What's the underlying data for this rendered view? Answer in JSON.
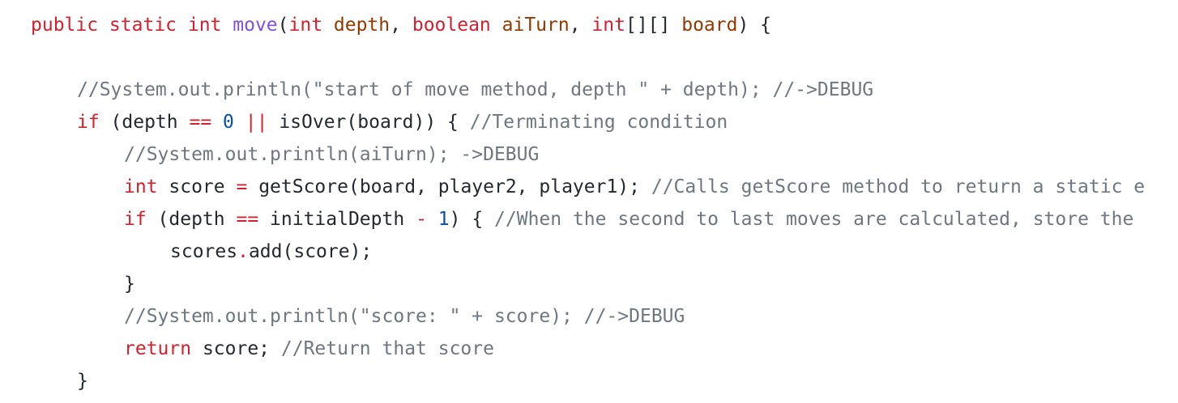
{
  "colors": {
    "background": "#ffffff",
    "keyword": "#cf222e",
    "function_name": "#8250df",
    "parameter": "#953800",
    "comment": "#6e7781",
    "number": "#0550ae",
    "plain": "#24292f"
  },
  "code": {
    "lines": [
      [
        {
          "t": "public static int ",
          "c": "kw"
        },
        {
          "t": "move",
          "c": "fn"
        },
        {
          "t": "(",
          "c": "tx"
        },
        {
          "t": "int ",
          "c": "kw"
        },
        {
          "t": "depth",
          "c": "pm"
        },
        {
          "t": ", ",
          "c": "tx"
        },
        {
          "t": "boolean ",
          "c": "kw"
        },
        {
          "t": "aiTurn",
          "c": "pm"
        },
        {
          "t": ", ",
          "c": "tx"
        },
        {
          "t": "int",
          "c": "kw"
        },
        {
          "t": "[][] ",
          "c": "tx"
        },
        {
          "t": "board",
          "c": "pm"
        },
        {
          "t": ") {",
          "c": "tx"
        }
      ],
      [],
      [
        {
          "t": "//System.out.println(\"start of move method, depth \" + depth); //->DEBUG",
          "c": "cm"
        }
      ],
      [
        {
          "t": "if ",
          "c": "kw"
        },
        {
          "t": "(depth ",
          "c": "tx"
        },
        {
          "t": "==",
          "c": "op"
        },
        {
          "t": " ",
          "c": "tx"
        },
        {
          "t": "0",
          "c": "num"
        },
        {
          "t": " ",
          "c": "tx"
        },
        {
          "t": "||",
          "c": "op"
        },
        {
          "t": " isOver(board)) { ",
          "c": "tx"
        },
        {
          "t": "//Terminating condition",
          "c": "cm"
        }
      ],
      [
        {
          "t": "//System.out.println(aiTurn); ->DEBUG",
          "c": "cm"
        }
      ],
      [
        {
          "t": "int ",
          "c": "kw"
        },
        {
          "t": "score ",
          "c": "tx"
        },
        {
          "t": "=",
          "c": "op"
        },
        {
          "t": " getScore(board, player2, player1); ",
          "c": "tx"
        },
        {
          "t": "//Calls getScore method to return a static e",
          "c": "cm"
        }
      ],
      [
        {
          "t": "if ",
          "c": "kw"
        },
        {
          "t": "(depth ",
          "c": "tx"
        },
        {
          "t": "==",
          "c": "op"
        },
        {
          "t": " initialDepth ",
          "c": "tx"
        },
        {
          "t": "-",
          "c": "op"
        },
        {
          "t": " ",
          "c": "tx"
        },
        {
          "t": "1",
          "c": "num"
        },
        {
          "t": ") { ",
          "c": "tx"
        },
        {
          "t": "//When the second to last moves are calculated, store the",
          "c": "cm"
        }
      ],
      [
        {
          "t": "scores",
          "c": "tx"
        },
        {
          "t": ".",
          "c": "op"
        },
        {
          "t": "add(score);",
          "c": "tx"
        }
      ],
      [
        {
          "t": "}",
          "c": "tx"
        }
      ],
      [
        {
          "t": "//System.out.println(\"score: \" + score); //->DEBUG",
          "c": "cm"
        }
      ],
      [
        {
          "t": "return ",
          "c": "kw"
        },
        {
          "t": "score; ",
          "c": "tx"
        },
        {
          "t": "//Return that score",
          "c": "cm"
        }
      ],
      [
        {
          "t": "}",
          "c": "tx"
        }
      ]
    ]
  }
}
